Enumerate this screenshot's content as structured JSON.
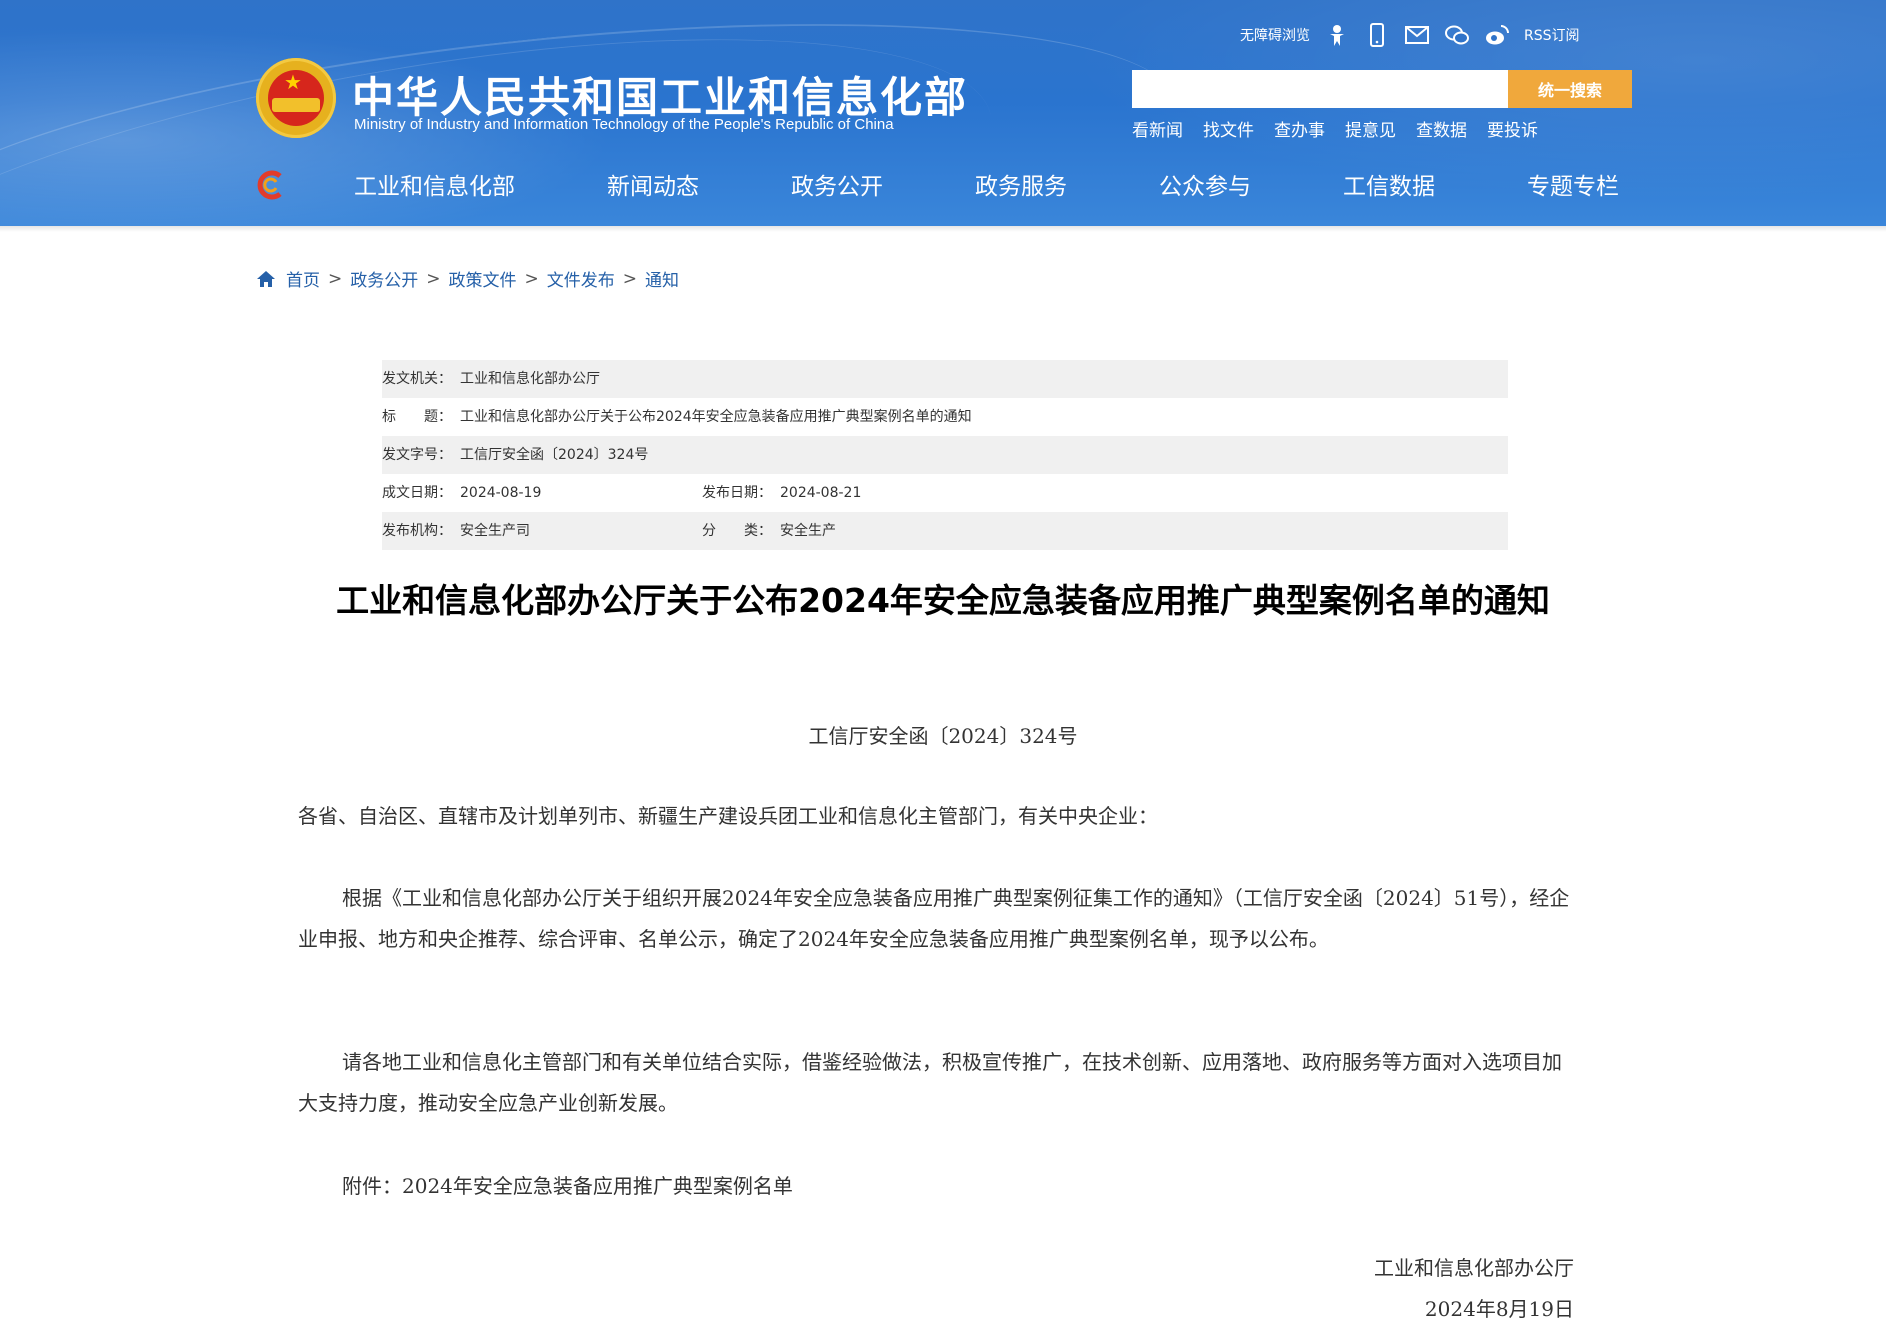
{
  "header": {
    "title_cn": "中华人民共和国工业和信息化部",
    "title_en": "Ministry of Industry and Information Technology of the People's Republic of China",
    "accessibility_label": "无障碍浏览",
    "rss_label": "RSS订阅",
    "search": {
      "placeholder": "",
      "button_label": "统一搜索"
    },
    "quick_links": [
      "看新闻",
      "找文件",
      "查办事",
      "提意见",
      "查数据",
      "要投诉"
    ]
  },
  "nav": {
    "items": [
      "工业和信息化部",
      "新闻动态",
      "政务公开",
      "政务服务",
      "公众参与",
      "工信数据",
      "专题专栏"
    ]
  },
  "breadcrumb": {
    "items": [
      "首页",
      "政务公开",
      "政策文件",
      "文件发布",
      "通知"
    ],
    "separator": ">"
  },
  "meta": {
    "issuer_label": "发文机关：",
    "issuer": "工业和信息化部办公厅",
    "title_label": "标　　题：",
    "title": "工业和信息化部办公厅关于公布2024年安全应急装备应用推广典型案例名单的通知",
    "docno_label": "发文字号：",
    "docno": "工信厅安全函〔2024〕324号",
    "date_created_label": "成文日期：",
    "date_created": "2024-08-19",
    "date_published_label": "发布日期：",
    "date_published": "2024-08-21",
    "agency_label": "发布机构：",
    "agency": "安全生产司",
    "category_label": "分　　类：",
    "category": "安全生产"
  },
  "article": {
    "title": "工业和信息化部办公厅关于公布2024年安全应急装备应用推广典型案例名单的通知",
    "doc_no": "工信厅安全函〔2024〕324号",
    "salutation": "各省、自治区、直辖市及计划单列市、新疆生产建设兵团工业和信息化主管部门，有关中央企业：",
    "para1": "根据《工业和信息化部办公厅关于组织开展2024年安全应急装备应用推广典型案例征集工作的通知》（工信厅安全函〔2024〕51号），经企业申报、地方和央企推荐、综合评审、名单公示，确定了2024年安全应急装备应用推广典型案例名单，现予以公布。",
    "para2": "请各地工业和信息化主管部门和有关单位结合实际，借鉴经验做法，积极宣传推广，在技术创新、应用落地、政府服务等方面对入选项目加大支持力度，推动安全应急产业创新发展。",
    "attachment": "附件：2024年安全应急装备应用推广典型案例名单",
    "signer": "工业和信息化部办公厅",
    "sign_date": "2024年8月19日"
  },
  "colors": {
    "header_blue": "#2a74cf",
    "search_button": "#f0a83c",
    "link_blue": "#2560a8",
    "meta_alt_row": "#f0f0f0"
  },
  "icons": [
    "emblem-icon",
    "accessibility-icon",
    "mobile-icon",
    "mail-icon",
    "wechat-icon",
    "weibo-icon",
    "home-icon",
    "site-c-logo-icon"
  ]
}
